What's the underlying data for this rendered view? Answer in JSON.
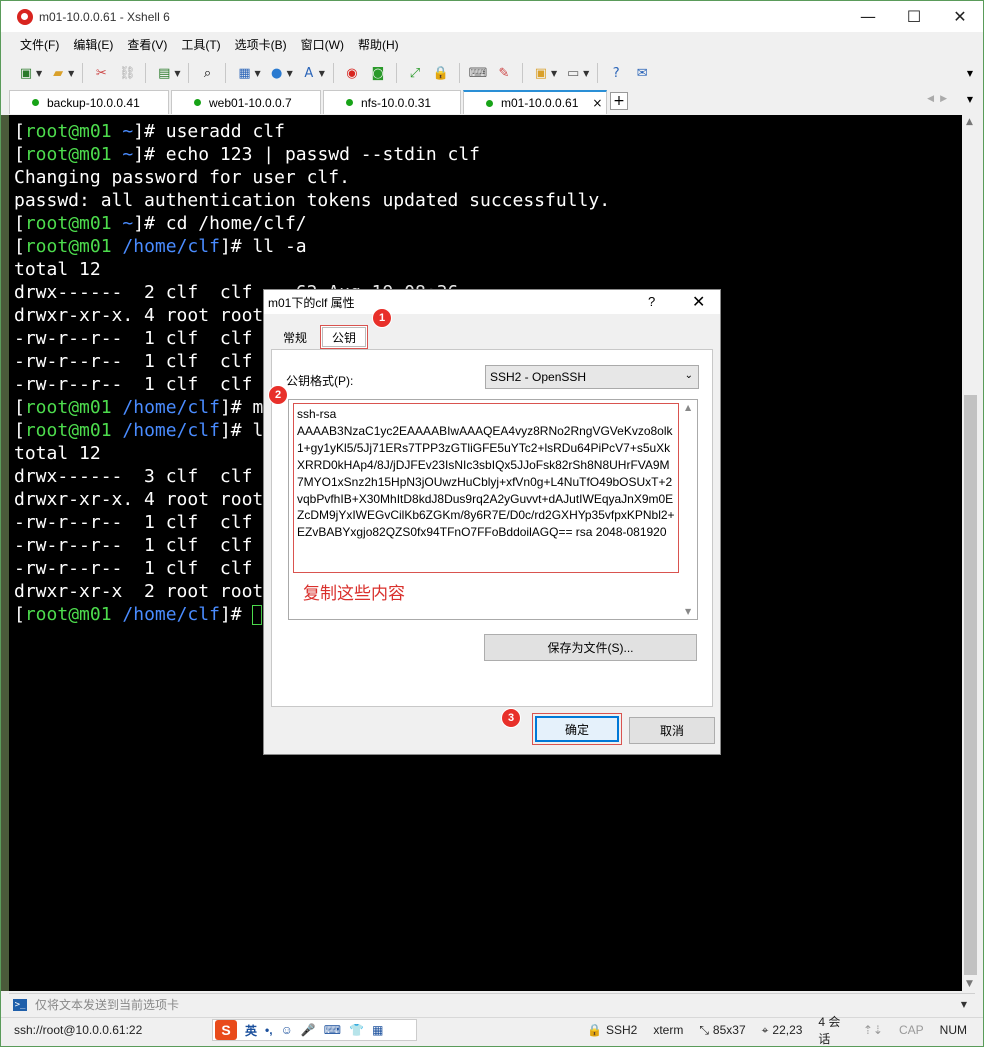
{
  "window": {
    "title": "m01-10.0.0.61 - Xshell 6"
  },
  "menu": [
    "文件(F)",
    "编辑(E)",
    "查看(V)",
    "工具(T)",
    "选项卡(B)",
    "窗口(W)",
    "帮助(H)"
  ],
  "tabs": [
    {
      "label": "backup-10.0.0.41"
    },
    {
      "label": "web01-10.0.0.7"
    },
    {
      "label": "nfs-10.0.0.31"
    },
    {
      "label": "m01-10.0.0.61",
      "close": "×"
    }
  ],
  "terminal": {
    "lines": [
      {
        "host": "[root@m01 ",
        "path": "~",
        "rest": "]# useradd clf"
      },
      {
        "host": "[root@m01 ",
        "path": "~",
        "rest": "]# echo 123 | passwd --stdin clf"
      },
      {
        "plain": "Changing password for user clf."
      },
      {
        "plain": "passwd: all authentication tokens updated successfully."
      },
      {
        "host": "[root@m01 ",
        "path": "~",
        "rest": "]# cd /home/clf/"
      },
      {
        "host": "[root@m01 ",
        "path": "/home/clf",
        "rest": "]# ll -a"
      },
      {
        "plain": "total 12"
      },
      {
        "plain": "drwx------  2 clf  clf    62 Aug 19 08:36 ."
      },
      {
        "plain": "drwxr-xr-x. 4 root root"
      },
      {
        "plain": "-rw-r--r--  1 clf  clf"
      },
      {
        "plain": "-rw-r--r--  1 clf  clf"
      },
      {
        "plain": "-rw-r--r--  1 clf  clf"
      },
      {
        "host": "[root@m01 ",
        "path": "/home/clf",
        "rest": "]# m"
      },
      {
        "host": "[root@m01 ",
        "path": "/home/clf",
        "rest": "]# l"
      },
      {
        "plain": "total 12"
      },
      {
        "plain": "drwx------  3 clf  clf"
      },
      {
        "plain": "drwxr-xr-x. 4 root root"
      },
      {
        "plain": "-rw-r--r--  1 clf  clf"
      },
      {
        "plain": "-rw-r--r--  1 clf  clf"
      },
      {
        "plain": "-rw-r--r--  1 clf  clf"
      },
      {
        "plain": "drwxr-xr-x  2 root root"
      },
      {
        "host": "[root@m01 ",
        "path": "/home/clf",
        "rest": "]# ",
        "cursor": true
      }
    ]
  },
  "sendbar": {
    "placeholder": "仅将文本发送到当前选项卡"
  },
  "status": {
    "connection": "ssh://root@10.0.0.61:22",
    "ime": [
      "英",
      "•,",
      "☺",
      "🎤",
      "⌨",
      "👕",
      "▦"
    ],
    "protocol": "SSH2",
    "term": "xterm",
    "size": "85x37",
    "pos": "22,23",
    "sessions": "4 会话",
    "cap": "CAP",
    "num": "NUM"
  },
  "dialog": {
    "title": "m01下的clf 属性",
    "help": "?",
    "close": "✕",
    "tab_general": "常规",
    "tab_pubkey": "公钥",
    "format_label": "公钥格式(P):",
    "format_value": "SSH2 - OpenSSH",
    "key_text": "ssh-rsa\nAAAAB3NzaC1yc2EAAAABIwAAAQEA4vyz8RNo2RngVGVeKvzo8olk1+gy1yKl5/5Jj71ERs7TPP3zGTliGFE5uYTc2+lsRDu64PiPcV7+s5uXkXRRD0kHAp4/8J/jDJFEv23IsNIc3sbIQx5JJoFsk82rSh8N8UHrFVA9M7MYO1xSnz2h15HpN3jOUwzHuCblyj+xfVn0g+L4NuTfO49bOSUxT+2vqbPvfhIB+X30MhItD8kdJ8Dus9rq2A2yGuvvt+dAJutIWEqyaJnX9m0EZcDM9jYxIWEGvCilKb6ZGKm/8y6R7E/D0c/rd2GXHYp35vfpxKPNbl2+EZvBABYxgjo82QZS0fx94TFnO7FFoBddoilAGQ== rsa 2048-081920",
    "note": "复制这些内容",
    "save_button": "保存为文件(S)...",
    "ok_button": "确定",
    "cancel_button": "取消"
  },
  "badges": [
    "1",
    "2",
    "3"
  ]
}
